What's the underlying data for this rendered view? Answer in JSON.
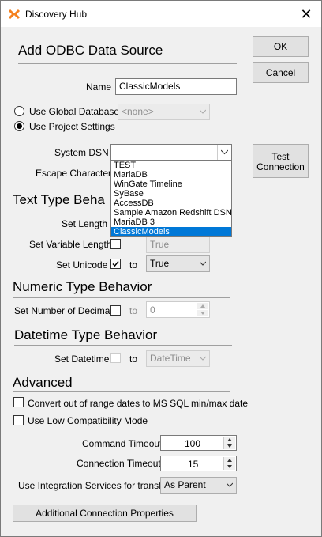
{
  "window": {
    "title": "Discovery Hub",
    "close_glyph": "✕"
  },
  "buttons": {
    "ok": "OK",
    "cancel": "Cancel",
    "test_connection": "Test Connection",
    "additional": "Additional Connection Properties"
  },
  "add_odbc": {
    "heading": "Add ODBC Data Source",
    "name_label": "Name",
    "name_value": "ClassicModels",
    "use_global_label": "Use Global Database",
    "global_value": "<none>",
    "use_project_label": "Use Project Settings",
    "system_dsn_label": "System DSN",
    "system_dsn_value": "",
    "escape_label": "Escape Character"
  },
  "dsn_options": [
    "TEST",
    "MariaDB",
    "WinGate Timeline",
    "SyBase",
    "AccessDB",
    "Sample Amazon Redshift DSN",
    "MariaDB 3",
    "ClassicModels"
  ],
  "dsn_selected_index": 7,
  "text_type": {
    "heading": "Text Type Beha",
    "set_length": "Set Length",
    "set_var_length": "Set Variable Length",
    "set_var_to_value": "True",
    "set_unicode": "Set Unicode",
    "to": "to",
    "unicode_value": "True"
  },
  "numeric": {
    "heading": "Numeric Type Behavior",
    "set_decimals": "Set Number of Decimals",
    "to": "to",
    "decimals_value": "0"
  },
  "datetime": {
    "heading": "Datetime Type Behavior",
    "set_datetime": "Set Datetime",
    "to": "to",
    "datetime_value": "DateTime"
  },
  "advanced": {
    "heading": "Advanced",
    "convert_label": "Convert out of range dates to MS SQL min/max date",
    "low_compat_label": "Use Low Compatibility Mode",
    "command_timeout_label": "Command Timeout",
    "command_timeout": "100",
    "connection_timeout_label": "Connection Timeout",
    "connection_timeout": "15",
    "integration_label": "Use Integration Services for transfer",
    "integration_value": "As Parent"
  }
}
